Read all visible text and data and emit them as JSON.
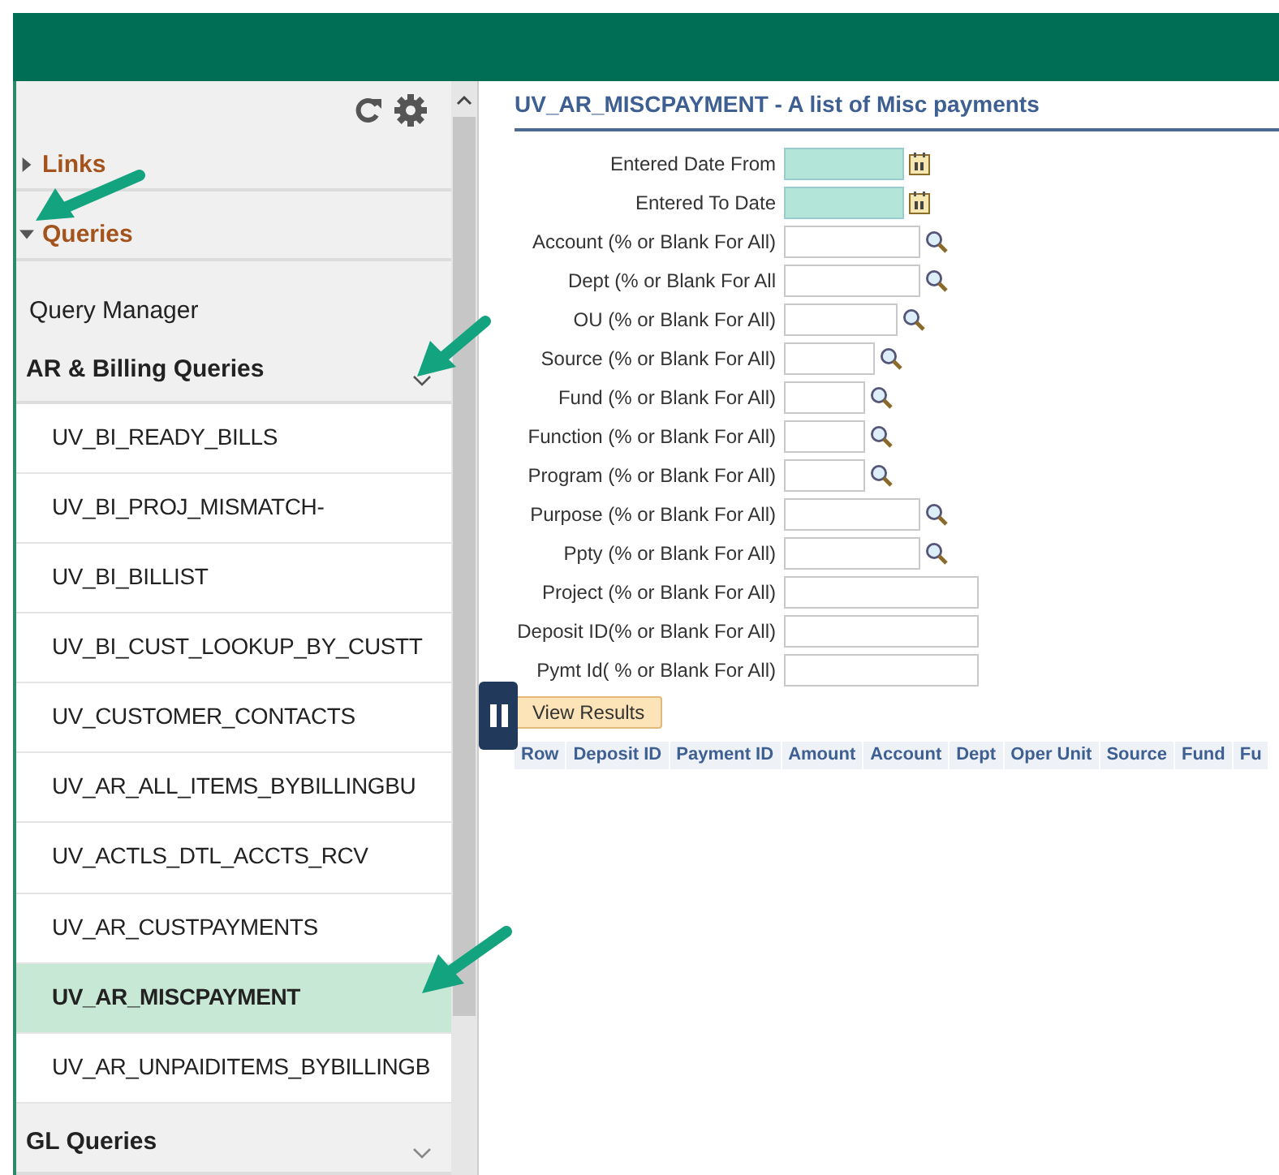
{
  "sidebar": {
    "sections": [
      {
        "label": "Links",
        "expanded": false
      },
      {
        "label": "Queries",
        "expanded": true
      }
    ],
    "links": [
      {
        "label": "Query Manager"
      }
    ],
    "groups": [
      {
        "label": "AR & Billing Queries",
        "expanded": true,
        "items": [
          {
            "label": "UV_BI_READY_BILLS",
            "selected": false
          },
          {
            "label": "UV_BI_PROJ_MISMATCH-",
            "selected": false
          },
          {
            "label": "UV_BI_BILLIST",
            "selected": false
          },
          {
            "label": "UV_BI_CUST_LOOKUP_BY_CUSTT",
            "selected": false
          },
          {
            "label": "UV_CUSTOMER_CONTACTS",
            "selected": false
          },
          {
            "label": "UV_AR_ALL_ITEMS_BYBILLINGBU",
            "selected": false
          },
          {
            "label": "UV_ACTLS_DTL_ACCTS_RCV",
            "selected": false
          },
          {
            "label": "UV_AR_CUSTPAYMENTS",
            "selected": false
          },
          {
            "label": "UV_AR_MISCPAYMENT",
            "selected": true
          },
          {
            "label": "UV_AR_UNPAIDITEMS_BYBILLINGB",
            "selected": false
          }
        ]
      },
      {
        "label": "GL Queries",
        "expanded": false
      }
    ]
  },
  "page": {
    "title": "UV_AR_MISCPAYMENT - A list of Misc payments",
    "fields": [
      {
        "label": "Entered Date From",
        "kind": "date"
      },
      {
        "label": "Entered To Date",
        "kind": "date"
      },
      {
        "label": "Account (% or Blank For All)",
        "kind": "lookup"
      },
      {
        "label": "Dept (% or Blank For All",
        "kind": "lookup"
      },
      {
        "label": "OU (% or Blank For All)",
        "kind": "lookup"
      },
      {
        "label": "Source (% or Blank For All)",
        "kind": "lookup"
      },
      {
        "label": "Fund (% or Blank For All)",
        "kind": "lookup"
      },
      {
        "label": "Function (% or Blank For All)",
        "kind": "lookup"
      },
      {
        "label": "Program (% or Blank For All)",
        "kind": "lookup"
      },
      {
        "label": "Purpose (% or Blank For All)",
        "kind": "lookup"
      },
      {
        "label": "Ppty (% or Blank For All)",
        "kind": "lookup"
      },
      {
        "label": "Project (% or Blank For All)",
        "kind": "plain"
      },
      {
        "label": "Deposit ID(% or Blank For All)",
        "kind": "plain"
      },
      {
        "label": "Pymt Id( % or Blank For All)",
        "kind": "plain"
      }
    ],
    "button": "View Results",
    "table": {
      "columns": [
        "Row",
        "Deposit ID",
        "Payment ID",
        "Amount",
        "Account",
        "Dept",
        "Oper Unit",
        "Source",
        "Fund",
        "Fu"
      ]
    }
  }
}
